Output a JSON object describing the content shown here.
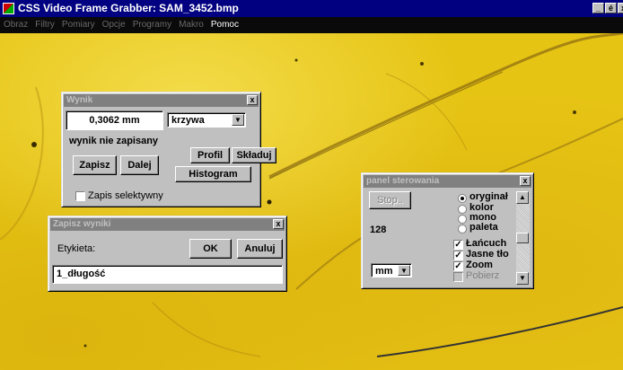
{
  "app": {
    "title": "CSS Video Frame Grabber: SAM_3452.bmp",
    "window_controls": [
      "_",
      "é",
      "x"
    ]
  },
  "menu": [
    {
      "label": "Obraz"
    },
    {
      "label": "Filtry"
    },
    {
      "label": "Pomiary"
    },
    {
      "label": "Opcje"
    },
    {
      "label": "Programy"
    },
    {
      "label": "Makro"
    },
    {
      "label": "Pomoc"
    }
  ],
  "wynik": {
    "title": "Wynik",
    "close": "x",
    "value": "0,3062 mm",
    "dropdown": "krzywa",
    "status": "wynik nie zapisany",
    "btn_profil": "Profil",
    "btn_skladuj": "Składuj",
    "btn_zapisz": "Zapisz",
    "btn_dalej": "Dalej",
    "btn_histogram": "Histogram",
    "check_label": "Zapis selektywny"
  },
  "zapisz": {
    "title": "Zapisz wyniki",
    "close": "x",
    "label": "Etykieta:",
    "ok": "OK",
    "cancel": "Anuluj",
    "value": "1_długość"
  },
  "panel": {
    "title": "panel sterowania",
    "close": "x",
    "stop": "Stop..",
    "number": "128",
    "units": "mm",
    "radios": [
      {
        "label": "oryginał",
        "checked": true
      },
      {
        "label": "kolor",
        "checked": false
      },
      {
        "label": "mono",
        "checked": false
      },
      {
        "label": "paleta",
        "checked": false
      }
    ],
    "checks": [
      {
        "label": "Łańcuch",
        "checked": true,
        "disabled": false
      },
      {
        "label": "Jasne tło",
        "checked": true,
        "disabled": false
      },
      {
        "label": "Zoom",
        "checked": true,
        "disabled": false
      },
      {
        "label": "Pobierz",
        "checked": false,
        "disabled": true
      }
    ]
  }
}
